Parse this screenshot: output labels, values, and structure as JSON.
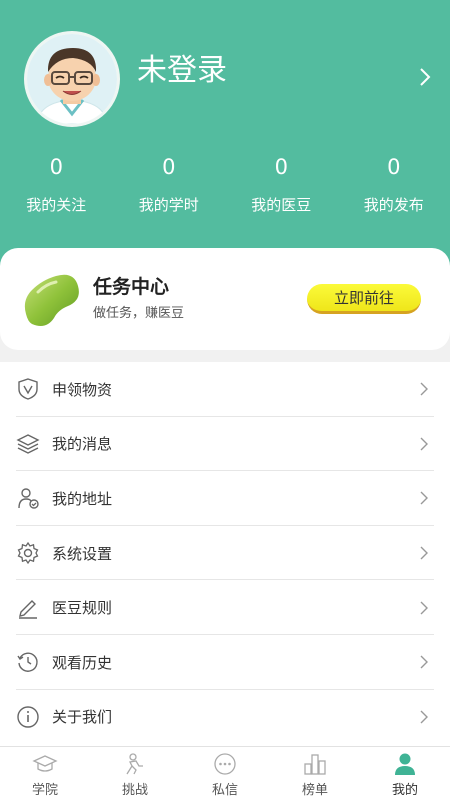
{
  "profile": {
    "username": "未登录"
  },
  "stats": [
    {
      "value": "0",
      "label": "我的关注"
    },
    {
      "value": "0",
      "label": "我的学时"
    },
    {
      "value": "0",
      "label": "我的医豆"
    },
    {
      "value": "0",
      "label": "我的发布"
    }
  ],
  "task": {
    "title": "任务中心",
    "subtitle": "做任务，赚医豆",
    "button": "立即前往"
  },
  "menu": [
    {
      "label": "申领物资",
      "icon": "shield-icon"
    },
    {
      "label": "我的消息",
      "icon": "layers-icon"
    },
    {
      "label": "我的地址",
      "icon": "user-check-icon"
    },
    {
      "label": "系统设置",
      "icon": "gear-icon"
    },
    {
      "label": "医豆规则",
      "icon": "pen-icon"
    },
    {
      "label": "观看历史",
      "icon": "history-icon"
    },
    {
      "label": "关于我们",
      "icon": "info-icon"
    }
  ],
  "tabs": [
    {
      "label": "学院",
      "icon": "graduation-cap-icon"
    },
    {
      "label": "挑战",
      "icon": "challenge-icon"
    },
    {
      "label": "私信",
      "icon": "chat-icon"
    },
    {
      "label": "榜单",
      "icon": "ranking-icon"
    },
    {
      "label": "我的",
      "icon": "person-icon",
      "active": true
    }
  ],
  "colors": {
    "header": "#53bc9f",
    "accent": "#3fb395",
    "button": "#fbfa3a"
  }
}
